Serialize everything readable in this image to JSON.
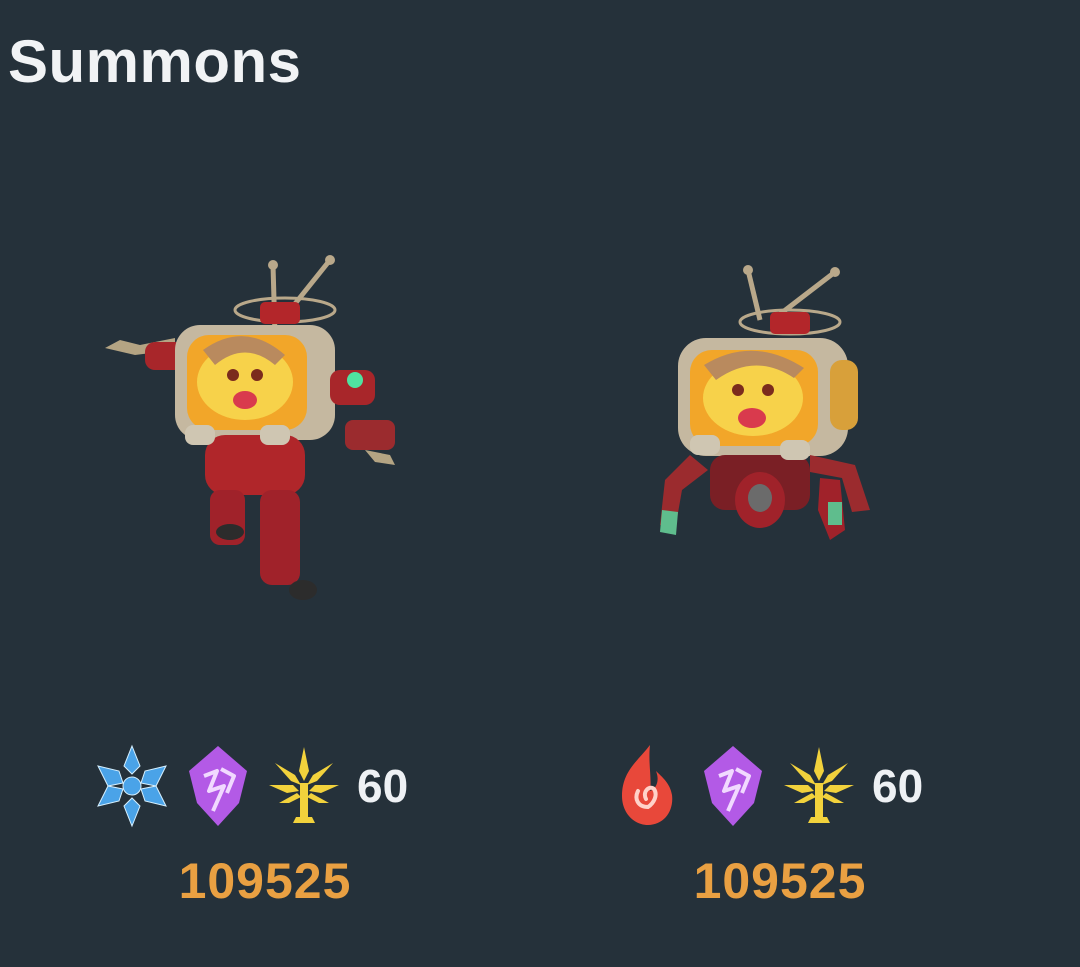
{
  "section": {
    "title": "Summons"
  },
  "summons": [
    {
      "portrait": "robot-summon-standing",
      "elements": [
        {
          "name": "cryo-icon",
          "color": "#4aa3e8"
        },
        {
          "name": "electro-icon",
          "color": "#b35ae6"
        },
        {
          "name": "dendro-tree-icon",
          "color": "#f2d23c"
        }
      ],
      "level": "60",
      "hp": "109525"
    },
    {
      "portrait": "robot-summon-crawler",
      "elements": [
        {
          "name": "pyro-icon",
          "color": "#e8483a"
        },
        {
          "name": "electro-icon",
          "color": "#b35ae6"
        },
        {
          "name": "dendro-tree-icon",
          "color": "#f2d23c"
        }
      ],
      "level": "60",
      "hp": "109525"
    }
  ]
}
